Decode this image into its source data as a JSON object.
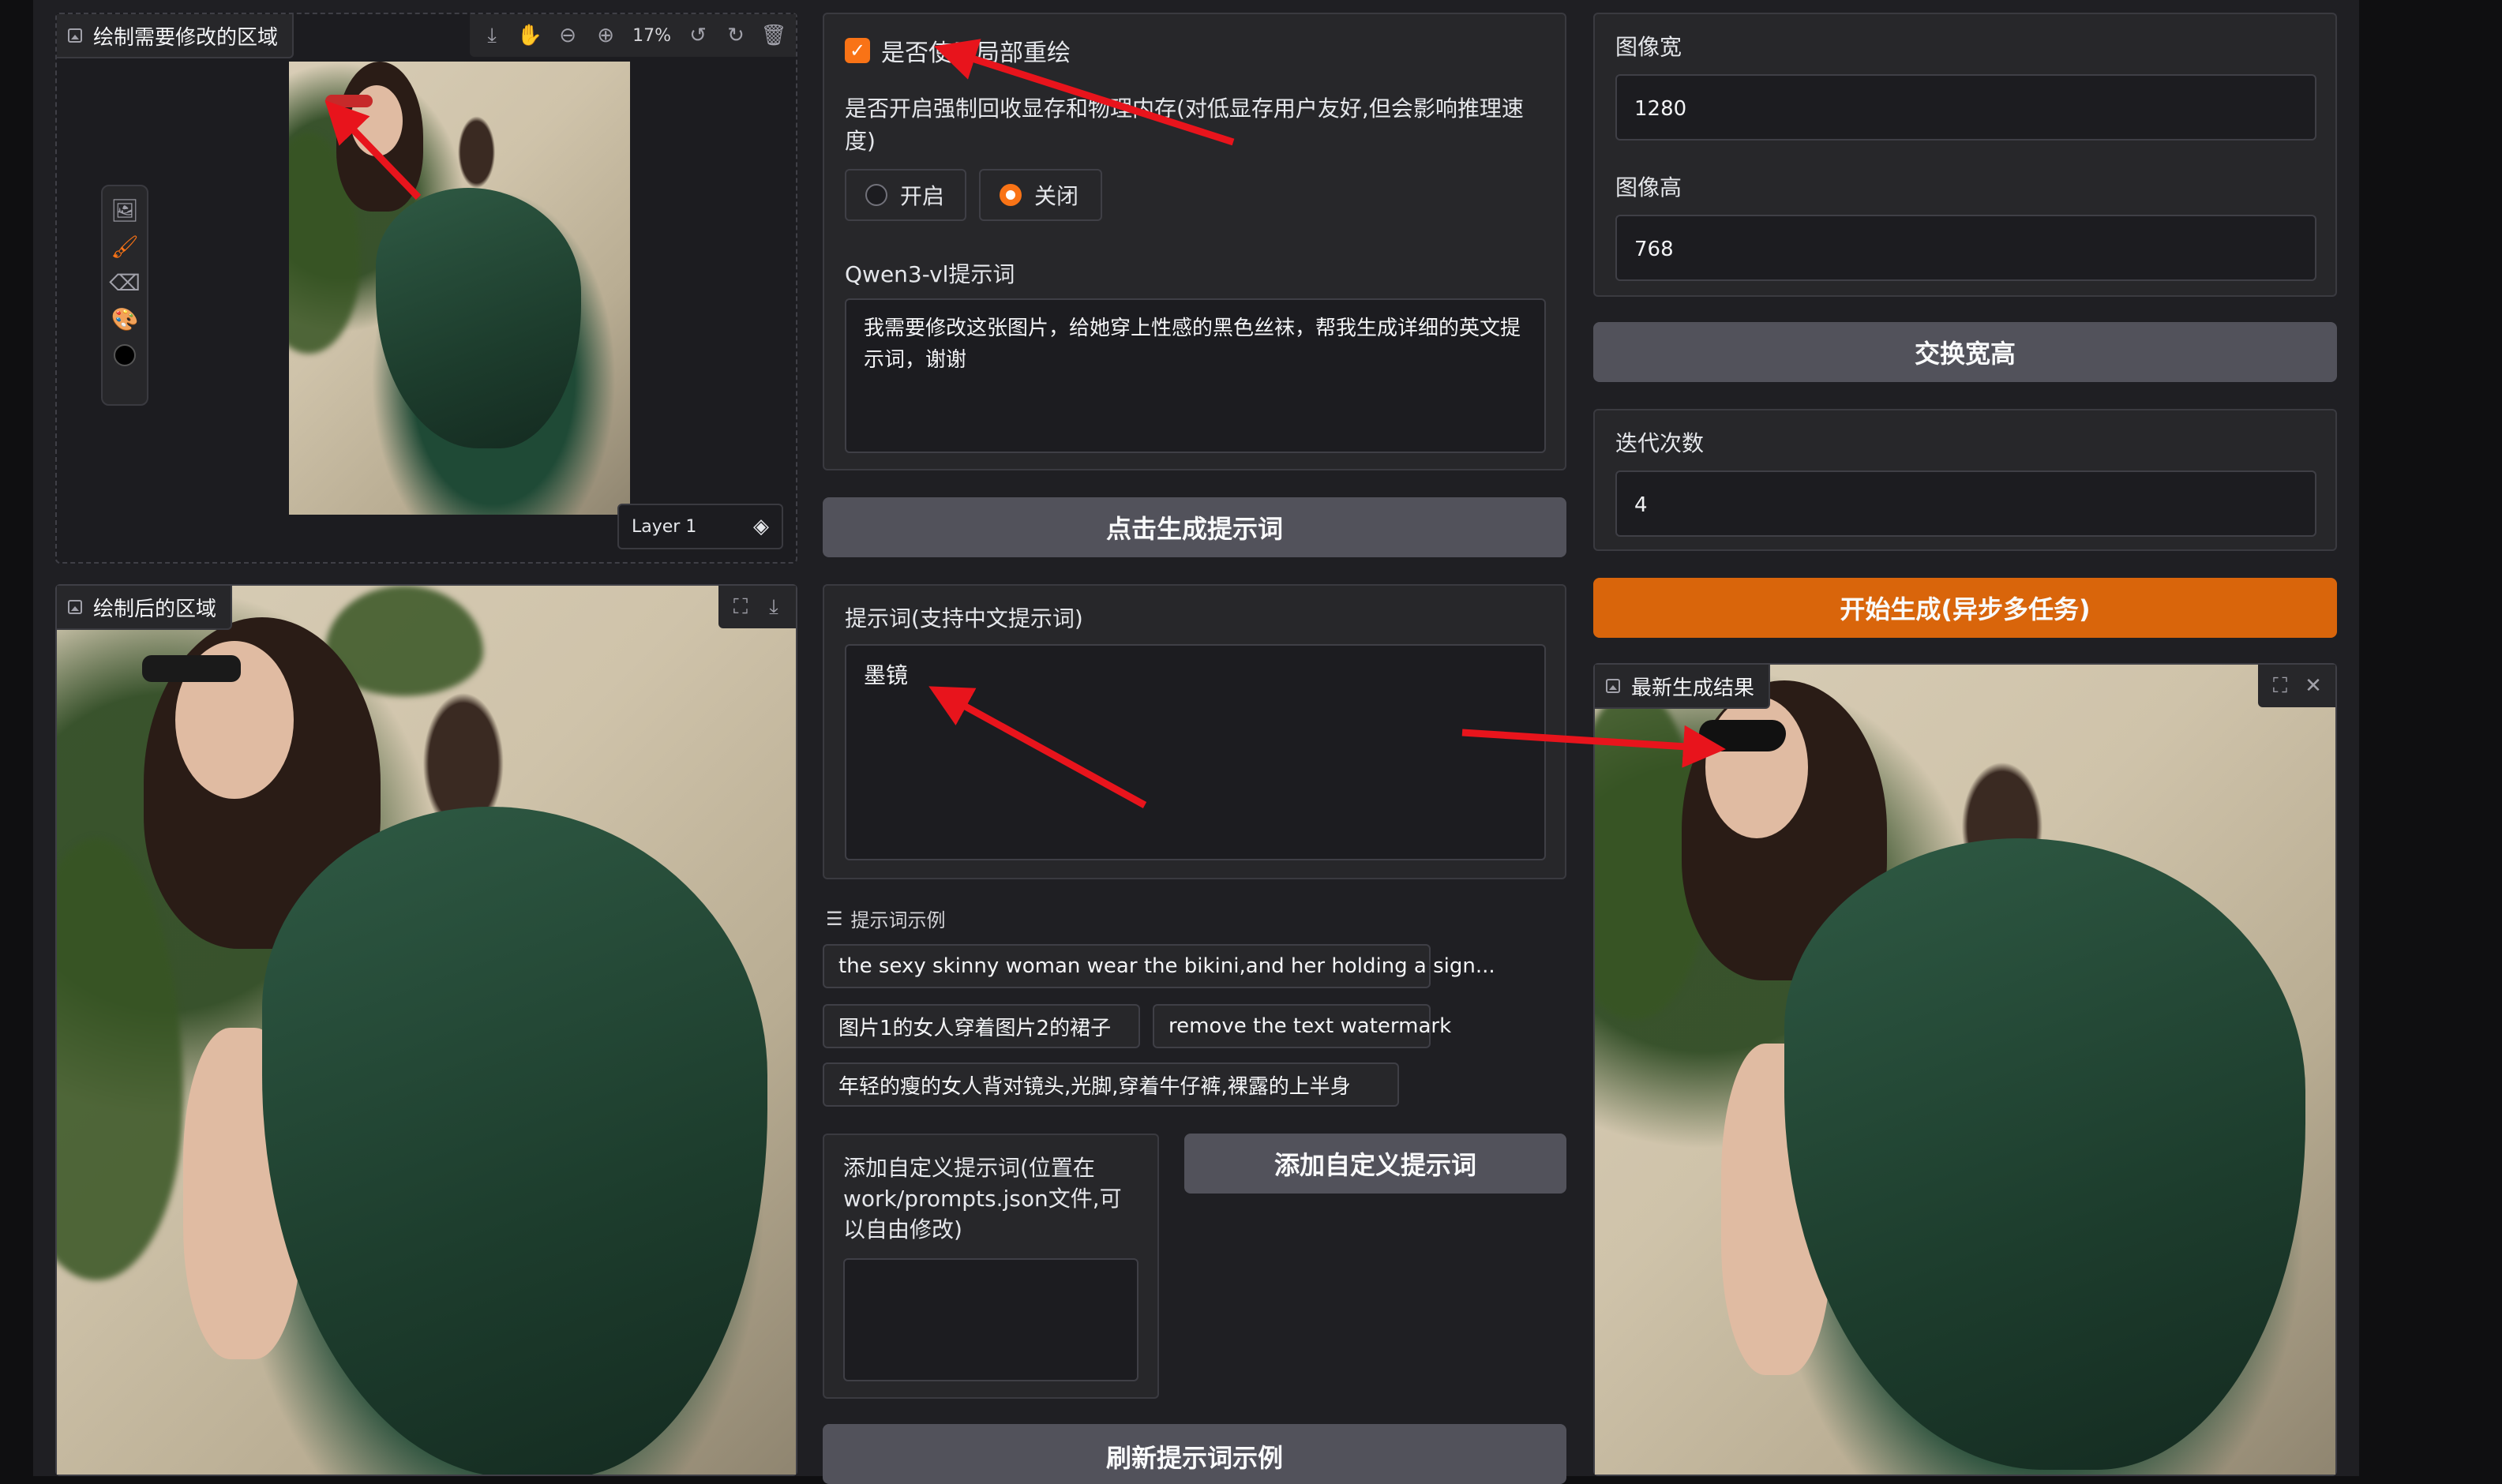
{
  "left_column": {
    "editor": {
      "label": "绘制需要修改的区域",
      "zoom": "17%",
      "layer_name": "Layer 1"
    },
    "result_panel": {
      "label": "绘制后的区域"
    }
  },
  "middle_column": {
    "partial_redraw_checkbox": {
      "label": "是否使用局部重绘",
      "checked": true
    },
    "memory_option": {
      "label": "是否开启强制回收显存和物理内存(对低显存用户友好,但会影响推理速度)",
      "options": [
        "开启",
        "关闭"
      ],
      "selected": "关闭"
    },
    "qwen_prompt": {
      "label": "Qwen3-vl提示词",
      "value": "我需要修改这张图片，给她穿上性感的黑色丝袜，帮我生成详细的英文提示词，谢谢"
    },
    "generate_prompt_button": "点击生成提示词",
    "prompt": {
      "label": "提示词(支持中文提示词)",
      "value": "墨镜"
    },
    "examples": {
      "header": "提示词示例",
      "items": [
        "the sexy skinny woman wear the bikini,and her holding a sign...",
        "图片1的女人穿着图片2的裙子",
        "remove the text watermark",
        "年轻的瘦的女人背对镜头,光脚,穿着牛仔裤,裸露的上半身"
      ]
    },
    "custom_prompt": {
      "label": "添加自定义提示词(位置在work/prompts.json文件,可以自由修改)",
      "value": ""
    },
    "add_custom_button": "添加自定义提示词",
    "refresh_examples_button": "刷新提示词示例"
  },
  "right_column": {
    "width": {
      "label": "图像宽",
      "value": "1280"
    },
    "height": {
      "label": "图像高",
      "value": "768"
    },
    "swap_button": "交换宽高",
    "iterations": {
      "label": "迭代次数",
      "value": "4"
    },
    "start_button": "开始生成(异步多任务)",
    "latest_result": {
      "label": "最新生成结果"
    }
  },
  "colors": {
    "accent": "#d9650b",
    "annotation_arrow": "#e8141c",
    "button_gray": "#52525b"
  }
}
